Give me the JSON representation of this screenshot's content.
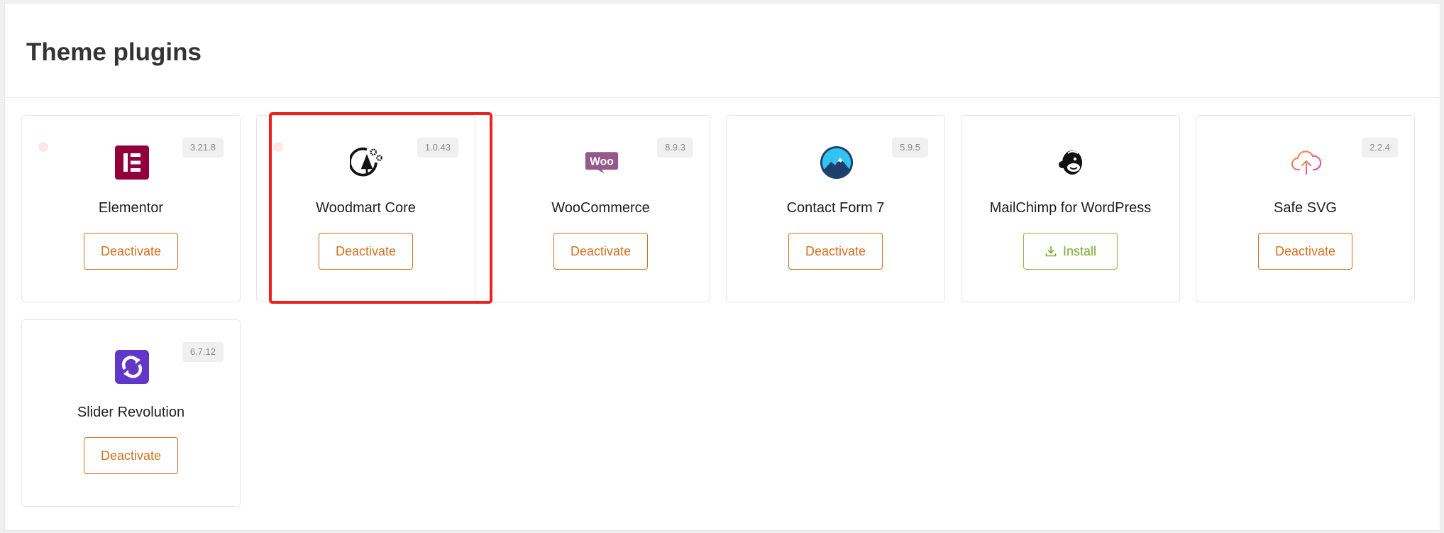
{
  "page_title": "Theme plugins",
  "colors": {
    "accent": "#d4701f",
    "install": "#7aab2c",
    "highlight": "#ef2020"
  },
  "plugins": [
    {
      "name": "Elementor",
      "version": "3.21.8",
      "action": "Deactivate",
      "icon": "elementor-icon"
    },
    {
      "name": "Woodmart Core",
      "version": "1.0.43",
      "action": "Deactivate",
      "icon": "woodmart-icon"
    },
    {
      "name": "WooCommerce",
      "version": "8.9.3",
      "action": "Deactivate",
      "icon": "woocommerce-icon"
    },
    {
      "name": "Contact Form 7",
      "version": "5.9.5",
      "action": "Deactivate",
      "icon": "contact-form-7-icon"
    },
    {
      "name": "MailChimp for WordPress",
      "version": "",
      "action": "Install",
      "icon": "mailchimp-icon"
    },
    {
      "name": "Safe SVG",
      "version": "2.2.4",
      "action": "Deactivate",
      "icon": "safe-svg-icon"
    },
    {
      "name": "Slider Revolution",
      "version": "6.7.12",
      "action": "Deactivate",
      "icon": "slider-revolution-icon"
    }
  ]
}
